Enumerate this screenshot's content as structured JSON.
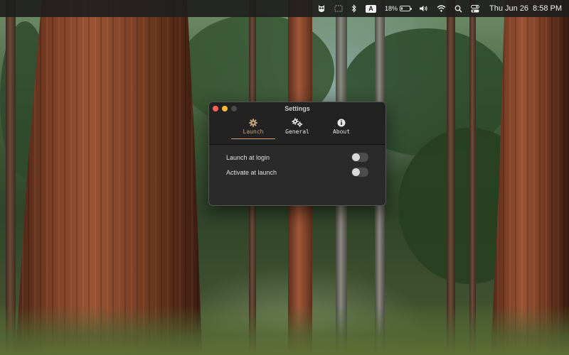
{
  "menubar": {
    "battery_percent": "18%",
    "battery_level": 0.18,
    "input_source": "A",
    "date": "Thu Jun 26",
    "time": "8:58 PM",
    "icons": [
      "owl-icon",
      "display-icon",
      "bluetooth-icon",
      "input-source-icon",
      "battery-icon",
      "volume-icon",
      "wifi-icon",
      "search-icon",
      "control-center-icon"
    ]
  },
  "window": {
    "title": "Settings",
    "tabs": [
      {
        "label": "Launch",
        "icon": "gear-icon",
        "active": true
      },
      {
        "label": "General",
        "icon": "gears-icon",
        "active": false
      },
      {
        "label": "About",
        "icon": "info-icon",
        "active": false
      }
    ],
    "settings": [
      {
        "label": "Launch at login",
        "enabled": false
      },
      {
        "label": "Activate at launch",
        "enabled": false
      }
    ]
  },
  "colors": {
    "accent": "#c9a37a",
    "window_bg": "#2a2a2a",
    "titlebar_bg": "#222222",
    "close": "#ff5f57",
    "minimize": "#febc2e",
    "toggle_off": "#4d4d4d"
  }
}
